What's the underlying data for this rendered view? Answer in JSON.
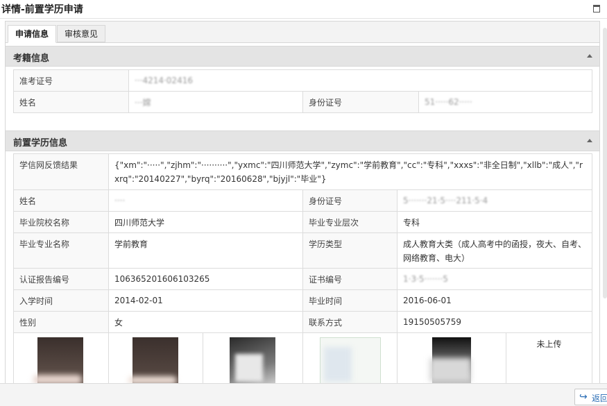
{
  "window": {
    "title": "详情-前置学历申请",
    "maximize_icon": "maximize-icon"
  },
  "tabs": [
    {
      "label": "申请信息",
      "active": true
    },
    {
      "label": "审核意见",
      "active": false
    }
  ],
  "section_exam": {
    "title": "考籍信息",
    "admission_label": "准考证号",
    "admission_value": "···4214·02416",
    "name_label": "姓名",
    "name_value": "···嫦",
    "id_label": "身份证号",
    "id_value": "51·····62·····"
  },
  "section_prior": {
    "title": "前置学历信息",
    "xuexin_label": "学信网反馈结果",
    "xuexin_value": "{\"xm\":\"·····\",\"zjhm\":\"··········\",\"yxmc\":\"四川师范大学\",\"zymc\":\"学前教育\",\"cc\":\"专科\",\"xxxs\":\"非全日制\",\"xllb\":\"成人\",\"rxrq\":\"20140227\",\"byrq\":\"20160628\",\"bjyjl\":\"毕业\"}",
    "name_label": "姓名",
    "name_value": "····",
    "id_label": "身份证号",
    "id_value": "5·······21·5····211·5·4",
    "school_label": "毕业院校名称",
    "school_value": "四川师范大学",
    "level_label": "毕业专业层次",
    "level_value": "专科",
    "major_label": "毕业专业名称",
    "major_value": "学前教育",
    "type_label": "学历类型",
    "type_value": "成人教育大类（成人高考中的函授，夜大、自考、网络教育、电大）",
    "report_label": "认证报告编号",
    "report_value": "106365201606103265",
    "cert_label": "证书编号",
    "cert_value": "1·3·5·······5",
    "enroll_label": "入学时间",
    "enroll_value": "2014-02-01",
    "grad_label": "毕业时间",
    "grad_value": "2016-06-01",
    "gender_label": "性别",
    "gender_value": "女",
    "contact_label": "联系方式",
    "contact_value": "19150505759",
    "not_uploaded": "未上传"
  },
  "footer": {
    "back_label": "返回"
  },
  "colors": {
    "section_bg": "#e4e4e4",
    "border": "#dcdcdc",
    "link": "#2a6db5"
  }
}
